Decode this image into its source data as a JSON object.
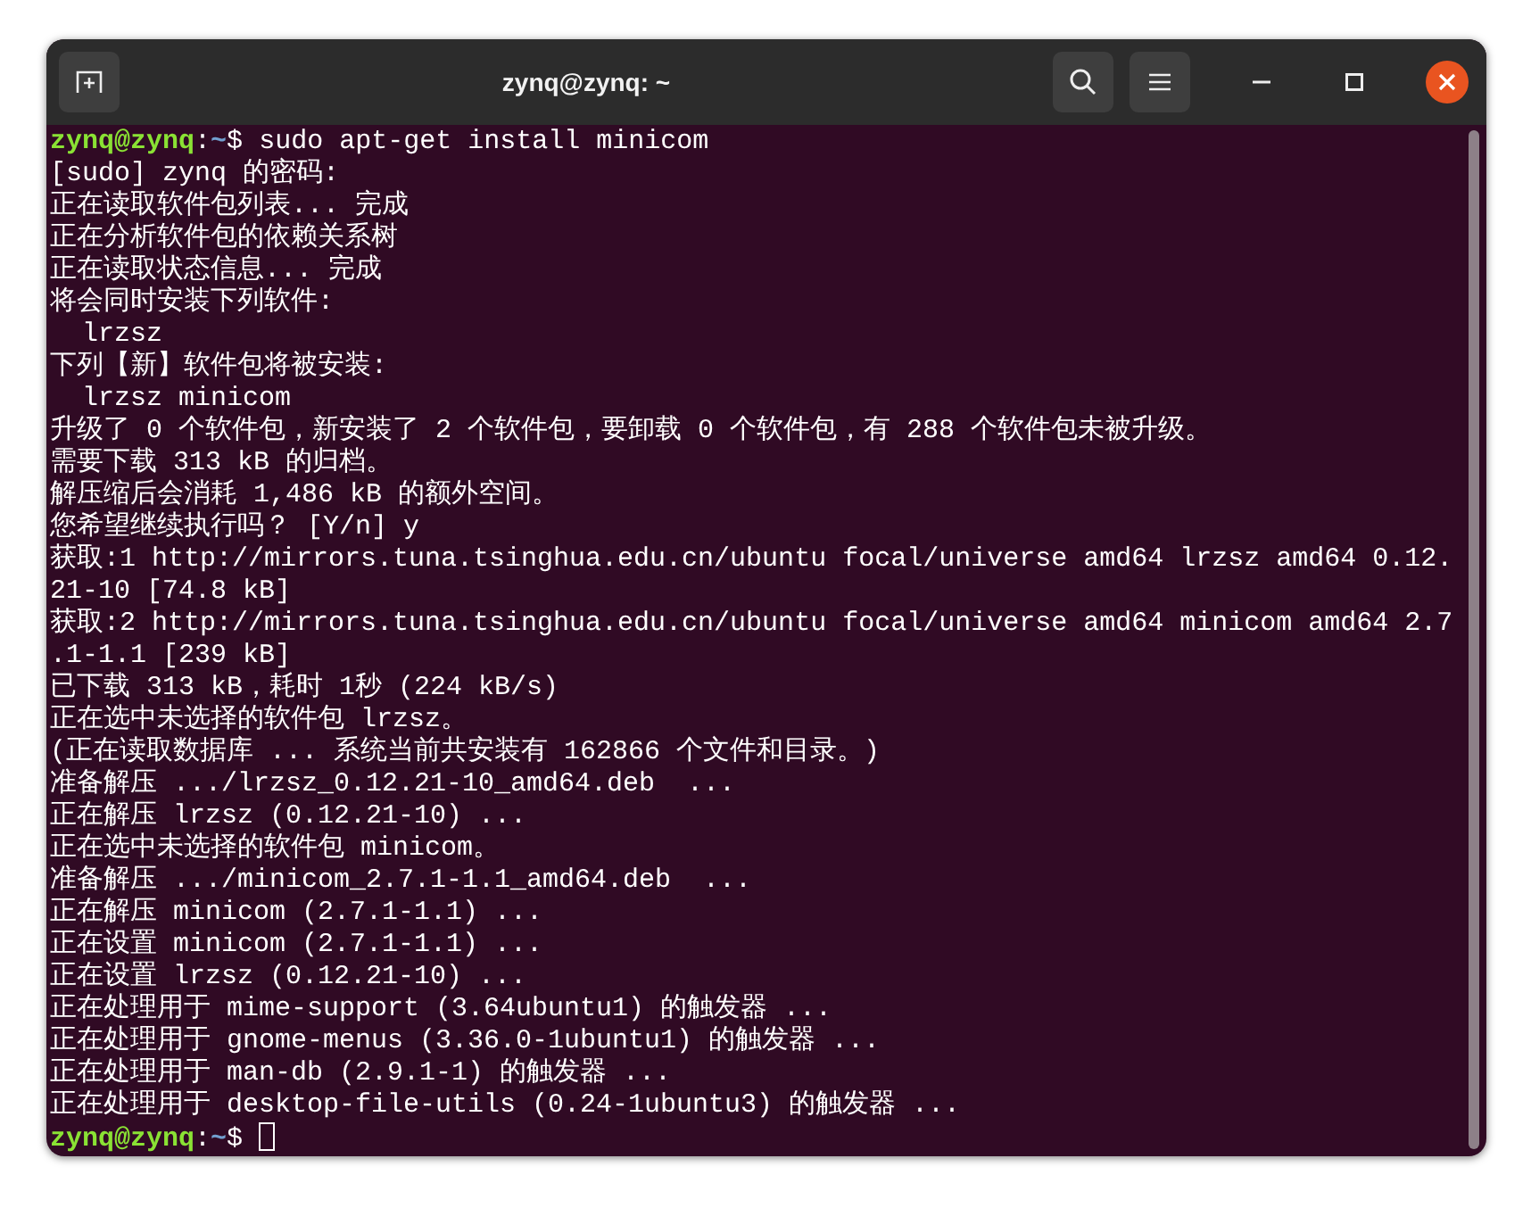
{
  "window": {
    "title": "zynq@zynq: ~"
  },
  "terminal": {
    "lines": [
      {
        "kind": "prompt",
        "user": "zynq@zynq",
        "colon": ":",
        "path": "~",
        "symbol": "$",
        "command": "sudo apt-get install minicom",
        "cursor": false
      },
      {
        "kind": "output",
        "text": "[sudo] zynq 的密码:"
      },
      {
        "kind": "output",
        "text": "正在读取软件包列表... 完成"
      },
      {
        "kind": "output",
        "text": "正在分析软件包的依赖关系树"
      },
      {
        "kind": "output",
        "text": "正在读取状态信息... 完成"
      },
      {
        "kind": "output",
        "text": "将会同时安装下列软件:"
      },
      {
        "kind": "output",
        "text": "  lrzsz"
      },
      {
        "kind": "output",
        "text": "下列【新】软件包将被安装:"
      },
      {
        "kind": "output",
        "text": "  lrzsz minicom"
      },
      {
        "kind": "output",
        "text": "升级了 0 个软件包，新安装了 2 个软件包，要卸载 0 个软件包，有 288 个软件包未被升级。"
      },
      {
        "kind": "output",
        "text": "需要下载 313 kB 的归档。"
      },
      {
        "kind": "output",
        "text": "解压缩后会消耗 1,486 kB 的额外空间。"
      },
      {
        "kind": "output",
        "text": "您希望继续执行吗？ [Y/n] y"
      },
      {
        "kind": "output",
        "text": "获取:1 http://mirrors.tuna.tsinghua.edu.cn/ubuntu focal/universe amd64 lrzsz amd64 0.12."
      },
      {
        "kind": "output",
        "text": "21-10 [74.8 kB]"
      },
      {
        "kind": "output",
        "text": "获取:2 http://mirrors.tuna.tsinghua.edu.cn/ubuntu focal/universe amd64 minicom amd64 2.7"
      },
      {
        "kind": "output",
        "text": ".1-1.1 [239 kB]"
      },
      {
        "kind": "output",
        "text": "已下载 313 kB，耗时 1秒 (224 kB/s)"
      },
      {
        "kind": "output",
        "text": "正在选中未选择的软件包 lrzsz。"
      },
      {
        "kind": "output",
        "text": "(正在读取数据库 ... 系统当前共安装有 162866 个文件和目录。)"
      },
      {
        "kind": "output",
        "text": "准备解压 .../lrzsz_0.12.21-10_amd64.deb  ..."
      },
      {
        "kind": "output",
        "text": "正在解压 lrzsz (0.12.21-10) ..."
      },
      {
        "kind": "output",
        "text": "正在选中未选择的软件包 minicom。"
      },
      {
        "kind": "output",
        "text": "准备解压 .../minicom_2.7.1-1.1_amd64.deb  ..."
      },
      {
        "kind": "output",
        "text": "正在解压 minicom (2.7.1-1.1) ..."
      },
      {
        "kind": "output",
        "text": "正在设置 minicom (2.7.1-1.1) ..."
      },
      {
        "kind": "output",
        "text": "正在设置 lrzsz (0.12.21-10) ..."
      },
      {
        "kind": "output",
        "text": "正在处理用于 mime-support (3.64ubuntu1) 的触发器 ..."
      },
      {
        "kind": "output",
        "text": "正在处理用于 gnome-menus (3.36.0-1ubuntu1) 的触发器 ..."
      },
      {
        "kind": "output",
        "text": "正在处理用于 man-db (2.9.1-1) 的触发器 ..."
      },
      {
        "kind": "output",
        "text": "正在处理用于 desktop-file-utils (0.24-1ubuntu3) 的触发器 ..."
      },
      {
        "kind": "prompt",
        "user": "zynq@zynq",
        "colon": ":",
        "path": "~",
        "symbol": "$",
        "cursor": true
      }
    ]
  }
}
